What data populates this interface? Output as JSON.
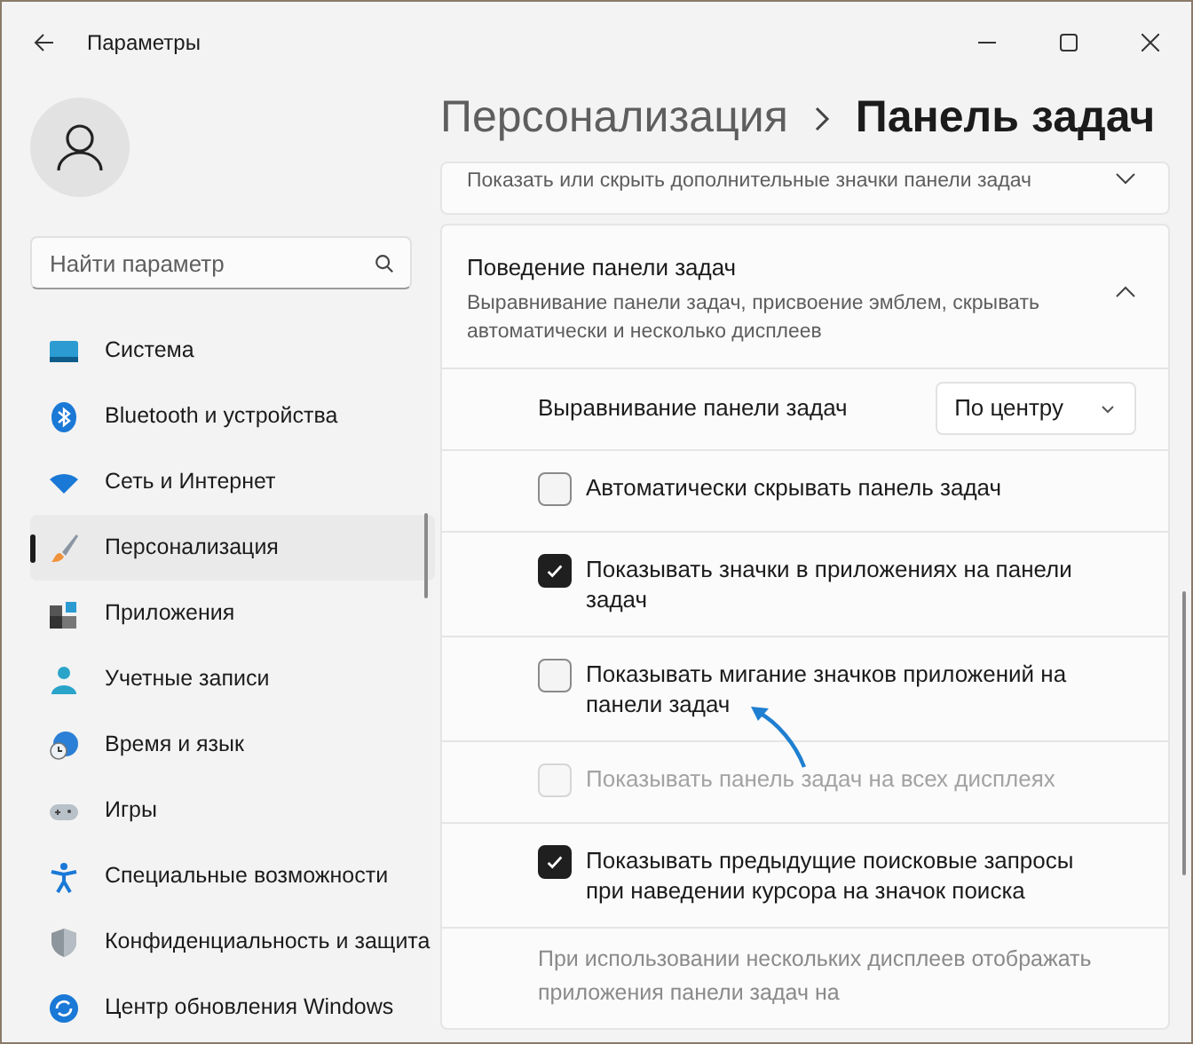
{
  "window": {
    "title": "Параметры"
  },
  "search": {
    "placeholder": "Найти параметр"
  },
  "sidebar": {
    "items": [
      {
        "label": "Система",
        "selected": false
      },
      {
        "label": "Bluetooth и устройства",
        "selected": false
      },
      {
        "label": "Сеть и Интернет",
        "selected": false
      },
      {
        "label": "Персонализация",
        "selected": true
      },
      {
        "label": "Приложения",
        "selected": false
      },
      {
        "label": "Учетные записи",
        "selected": false
      },
      {
        "label": "Время и язык",
        "selected": false
      },
      {
        "label": "Игры",
        "selected": false
      },
      {
        "label": "Специальные возможности",
        "selected": false
      },
      {
        "label": "Конфиденциальность и защита",
        "selected": false
      },
      {
        "label": "Центр обновления Windows",
        "selected": false
      }
    ]
  },
  "breadcrumb": {
    "parent": "Персонализация",
    "current": "Панель задач"
  },
  "sections": [
    {
      "subtitle": "Показать или скрыть дополнительные значки панели задач",
      "expanded": false
    },
    {
      "title": "Поведение панели задач",
      "subtitle": "Выравнивание панели задач, присвоение эмблем, скрывать автоматически и несколько дисплеев",
      "expanded": true,
      "rows": [
        {
          "kind": "select",
          "label": "Выравнивание панели задач",
          "value": "По центру"
        },
        {
          "kind": "checkbox",
          "label": "Автоматически скрывать панель задач",
          "checked": false,
          "disabled": false
        },
        {
          "kind": "checkbox",
          "label": "Показывать значки в приложениях на панели задач",
          "checked": true,
          "disabled": false
        },
        {
          "kind": "checkbox",
          "label": "Показывать мигание значков приложений на панели задач",
          "checked": false,
          "disabled": false
        },
        {
          "kind": "checkbox",
          "label": "Показывать панель задач на всех дисплеях",
          "checked": false,
          "disabled": true
        },
        {
          "kind": "checkbox",
          "label": "Показывать предыдущие поисковые запросы при наведении курсора на значок поиска",
          "checked": true,
          "disabled": false
        },
        {
          "kind": "note",
          "label": "При использовании нескольких дисплеев отображать приложения панели задач на"
        }
      ]
    }
  ]
}
